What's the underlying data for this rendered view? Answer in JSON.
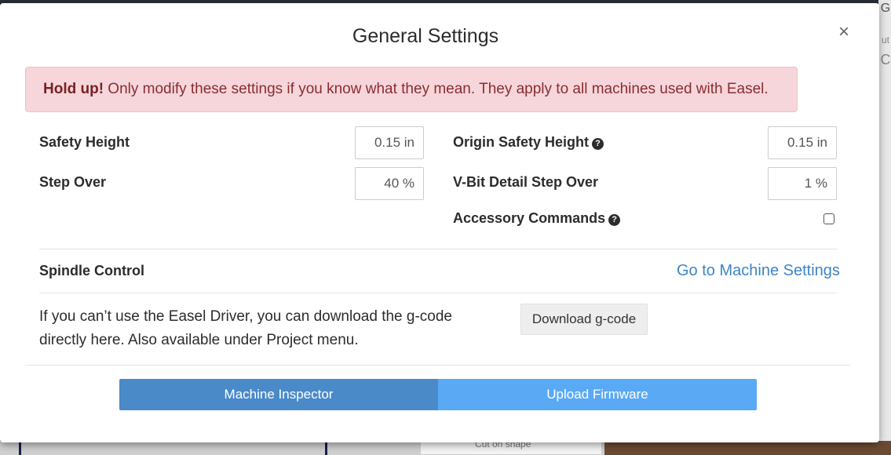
{
  "background": {
    "side_chars": [
      "G",
      "ut",
      "C"
    ],
    "bottom_panel_text": "Cut on shape"
  },
  "modal": {
    "title": "General Settings",
    "close_symbol": "×"
  },
  "alert": {
    "strong": "Hold up!",
    "message": " Only modify these settings if you know what they mean. They apply to all machines used with Easel."
  },
  "settings": {
    "safety_height": {
      "label": "Safety Height",
      "value": "0.15 in"
    },
    "step_over": {
      "label": "Step Over",
      "value": "40 %"
    },
    "origin_safety_height": {
      "label": "Origin Safety Height",
      "value": "0.15 in"
    },
    "vbit_step_over": {
      "label": "V-Bit Detail Step Over",
      "value": "1 %"
    },
    "accessory_commands": {
      "label": "Accessory Commands",
      "checked": false
    },
    "help_icon_glyph": "?"
  },
  "spindle": {
    "label": "Spindle Control",
    "link": "Go to Machine Settings"
  },
  "gcode": {
    "info": "If you can’t use the Easel Driver, you can download the g-code directly here. Also available under Project menu.",
    "button": "Download g-code"
  },
  "footer": {
    "inspector": "Machine Inspector",
    "firmware": "Upload Firmware"
  },
  "colors": {
    "alert_bg": "#f6d6da",
    "alert_text": "#8a2d33",
    "link": "#3d85c6",
    "inspector_btn": "#4a8ac9",
    "firmware_btn": "#5aa9f5"
  }
}
